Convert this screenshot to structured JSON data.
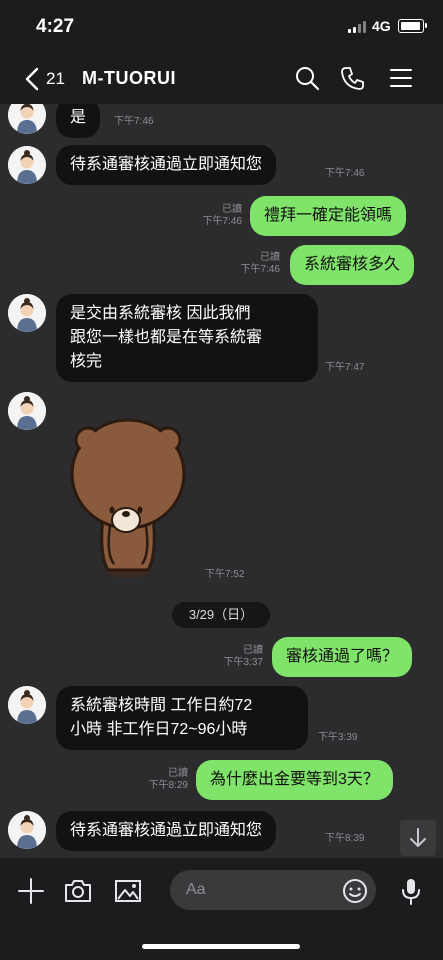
{
  "status_bar": {
    "time": "4:27",
    "network": "4G"
  },
  "header": {
    "back_count": "21",
    "title": "M-TUORUI"
  },
  "messages": [
    {
      "id": "m1",
      "direction": "in",
      "text": "是",
      "time": "下午7:46"
    },
    {
      "id": "m2",
      "direction": "in",
      "text": "待系通審核通過立即通知您",
      "time": "下午7:46"
    },
    {
      "id": "m3",
      "direction": "out",
      "text": "禮拜一確定能領嗎",
      "read": "已讀",
      "time": "下午7:46"
    },
    {
      "id": "m4",
      "direction": "out",
      "text": "系統審核多久",
      "read": "已讀",
      "time": "下午7:46"
    },
    {
      "id": "m5",
      "direction": "in",
      "lines": [
        "是交由系統審核  因此我們",
        "跟您一樣也都是在等系統審",
        "核完"
      ],
      "time": "下午7:47"
    },
    {
      "id": "m6",
      "direction": "in",
      "sticker": "brown-bear-bow-sticker",
      "time": "下午7:52"
    },
    {
      "id": "m7",
      "direction": "out",
      "text": "審核通過了嗎？",
      "read": "已讀",
      "time": "下午3:37"
    },
    {
      "id": "m8",
      "direction": "in",
      "lines": [
        "系統審核時間 工作日約72",
        "小時 非工作日72~96小時"
      ],
      "time": "下午3:39"
    },
    {
      "id": "m9",
      "direction": "out",
      "text": "為什麼出金要等到3天？",
      "read": "已讀",
      "time": "下午8:29"
    },
    {
      "id": "m10",
      "direction": "in",
      "text": "待系通審核通過立即通知您",
      "time": "下午8:39"
    }
  ],
  "date_separator": "3/29（日）",
  "input": {
    "placeholder": "Aa"
  },
  "icons": {
    "back": "chevron-left-icon",
    "search": "search-icon",
    "call": "phone-icon",
    "menu": "hamburger-menu-icon",
    "add": "plus-icon",
    "camera": "camera-icon",
    "image": "image-icon",
    "emoji": "emoji-icon",
    "mic": "microphone-icon",
    "scroll": "arrow-down-icon"
  },
  "colors": {
    "outgoing_bubble": "#80e36a",
    "incoming_bubble": "#121212",
    "chat_background": "#2c2c2e",
    "bar_background": "#1c1c1e"
  }
}
